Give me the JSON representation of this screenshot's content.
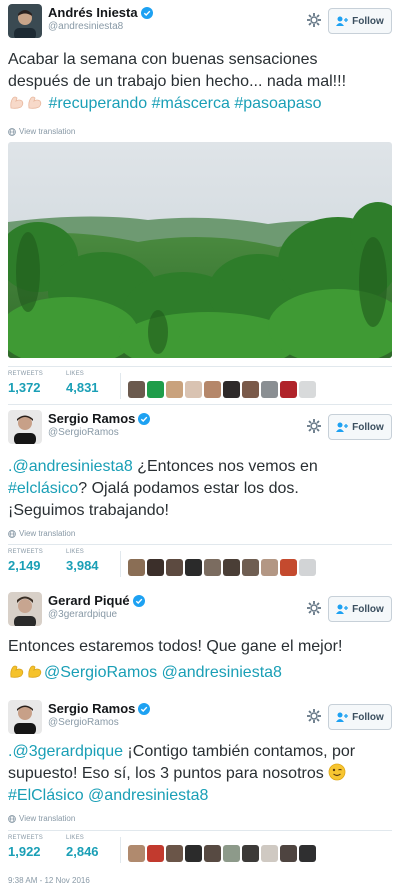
{
  "tweets": [
    {
      "author": "Andrés Iniesta",
      "handle": "@andresiniesta8",
      "follow_label": "Follow",
      "text_line1": "Acabar la semana con buenas sensaciones",
      "text_line2": "después de un trabajo bien hecho... nada mal!!!",
      "hashtags": "#recuperando #máscerca #pasoapaso",
      "emoji": "flexed-biceps-icon x2",
      "view_translation": "View translation",
      "retweets_label": "RETWEETS",
      "retweets": "1,372",
      "likes_label": "LIKES",
      "likes": "4,831"
    },
    {
      "author": "Sergio Ramos",
      "handle": "@SergioRamos",
      "follow_label": "Follow",
      "mention": ".@andresiniesta8",
      "text_a": " ¿Entonces nos vemos en",
      "hashtag": "#elclásico",
      "text_b": "? Ojalá podamos estar los dos.",
      "text_c": "¡Seguimos trabajando!",
      "view_translation": "View translation",
      "retweets_label": "RETWEETS",
      "retweets": "2,149",
      "likes_label": "LIKES",
      "likes": "3,984"
    },
    {
      "author": "Gerard Piqué",
      "handle": "@3gerardpique",
      "follow_label": "Follow",
      "text_line1": "Entonces estaremos todos! Que gane el mejor!",
      "mentions": "@SergioRamos @andresiniesta8",
      "emoji": "flexed-biceps-icon x2"
    },
    {
      "author": "Sergio Ramos",
      "handle": "@SergioRamos",
      "follow_label": "Follow",
      "mention": ".@3gerardpique",
      "text_a": " ¡Contigo también contamos, por",
      "text_b": "supuesto! Eso sí, los 3 puntos para nosotros",
      "hashtag": "#ElClásico",
      "mention2": "@andresiniesta8",
      "emoji": "winking-face-icon",
      "view_translation": "View translation",
      "retweets_label": "RETWEETS",
      "retweets": "1,922",
      "likes_label": "LIKES",
      "likes": "2,846",
      "timestamp": "9:38 AM - 12 Nov 2016"
    }
  ],
  "colors": {
    "link": "#1a9fb6",
    "verified": "#1da1f2",
    "muted": "#8899a6"
  }
}
